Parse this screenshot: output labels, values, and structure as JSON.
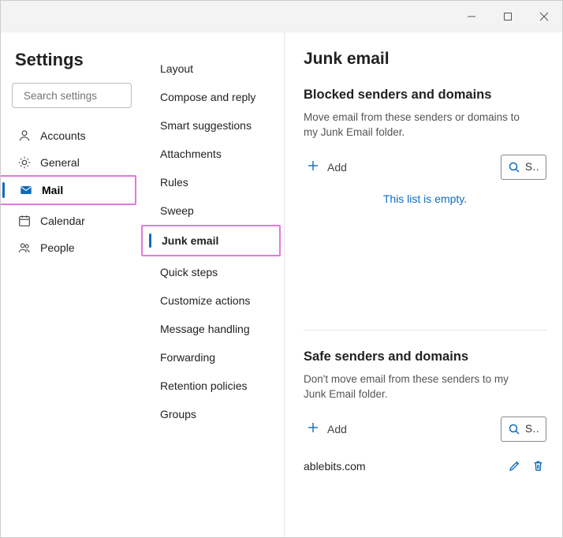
{
  "window": {
    "title": "Settings"
  },
  "sidebar": {
    "title": "Settings",
    "search_placeholder": "Search settings",
    "items": [
      {
        "label": "Accounts",
        "icon": "person"
      },
      {
        "label": "General",
        "icon": "gear"
      },
      {
        "label": "Mail",
        "icon": "mail",
        "active": true
      },
      {
        "label": "Calendar",
        "icon": "calendar"
      },
      {
        "label": "People",
        "icon": "people"
      }
    ]
  },
  "submenu": {
    "items": [
      "Layout",
      "Compose and reply",
      "Smart suggestions",
      "Attachments",
      "Rules",
      "Sweep",
      "Junk email",
      "Quick steps",
      "Customize actions",
      "Message handling",
      "Forwarding",
      "Retention policies",
      "Groups"
    ],
    "active_index": 6
  },
  "content": {
    "title": "Junk email",
    "blocked": {
      "title": "Blocked senders and domains",
      "desc": "Move email from these senders or domains to my Junk Email folder.",
      "add_label": "Add",
      "search_label": "S…",
      "empty_text": "This list is empty."
    },
    "safe": {
      "title": "Safe senders and domains",
      "desc": "Don't move email from these senders to my Junk Email folder.",
      "add_label": "Add",
      "search_label": "S…",
      "items": [
        {
          "value": "ablebits.com"
        }
      ]
    }
  }
}
